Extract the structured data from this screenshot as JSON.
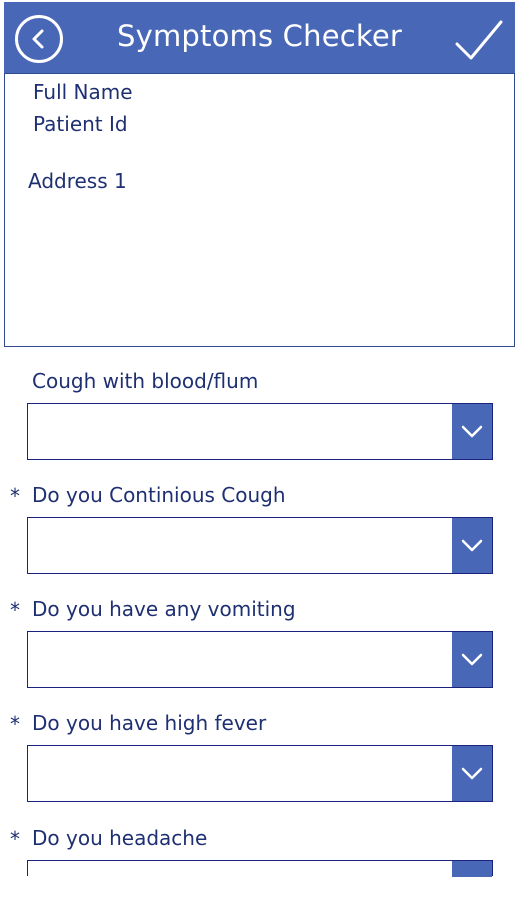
{
  "header": {
    "title": "Symptoms Checker",
    "back_icon": "back-arrow-icon",
    "confirm_icon": "checkmark-icon"
  },
  "patient": {
    "full_name_label": "Full Name",
    "patient_id_label": "Patient Id",
    "address_label": "Address 1"
  },
  "form": {
    "questions": [
      {
        "label": "Cough with blood/flum",
        "required": false,
        "value": ""
      },
      {
        "label": "Do you Continious Cough",
        "required": true,
        "value": ""
      },
      {
        "label": "Do you have any vomiting",
        "required": true,
        "value": ""
      },
      {
        "label": "Do you have high fever",
        "required": true,
        "value": ""
      },
      {
        "label": "Do you headache",
        "required": true,
        "value": ""
      }
    ],
    "required_marker": "*"
  },
  "colors": {
    "primary": "#4967b7",
    "text": "#1f3072",
    "border": "#1a237e"
  }
}
